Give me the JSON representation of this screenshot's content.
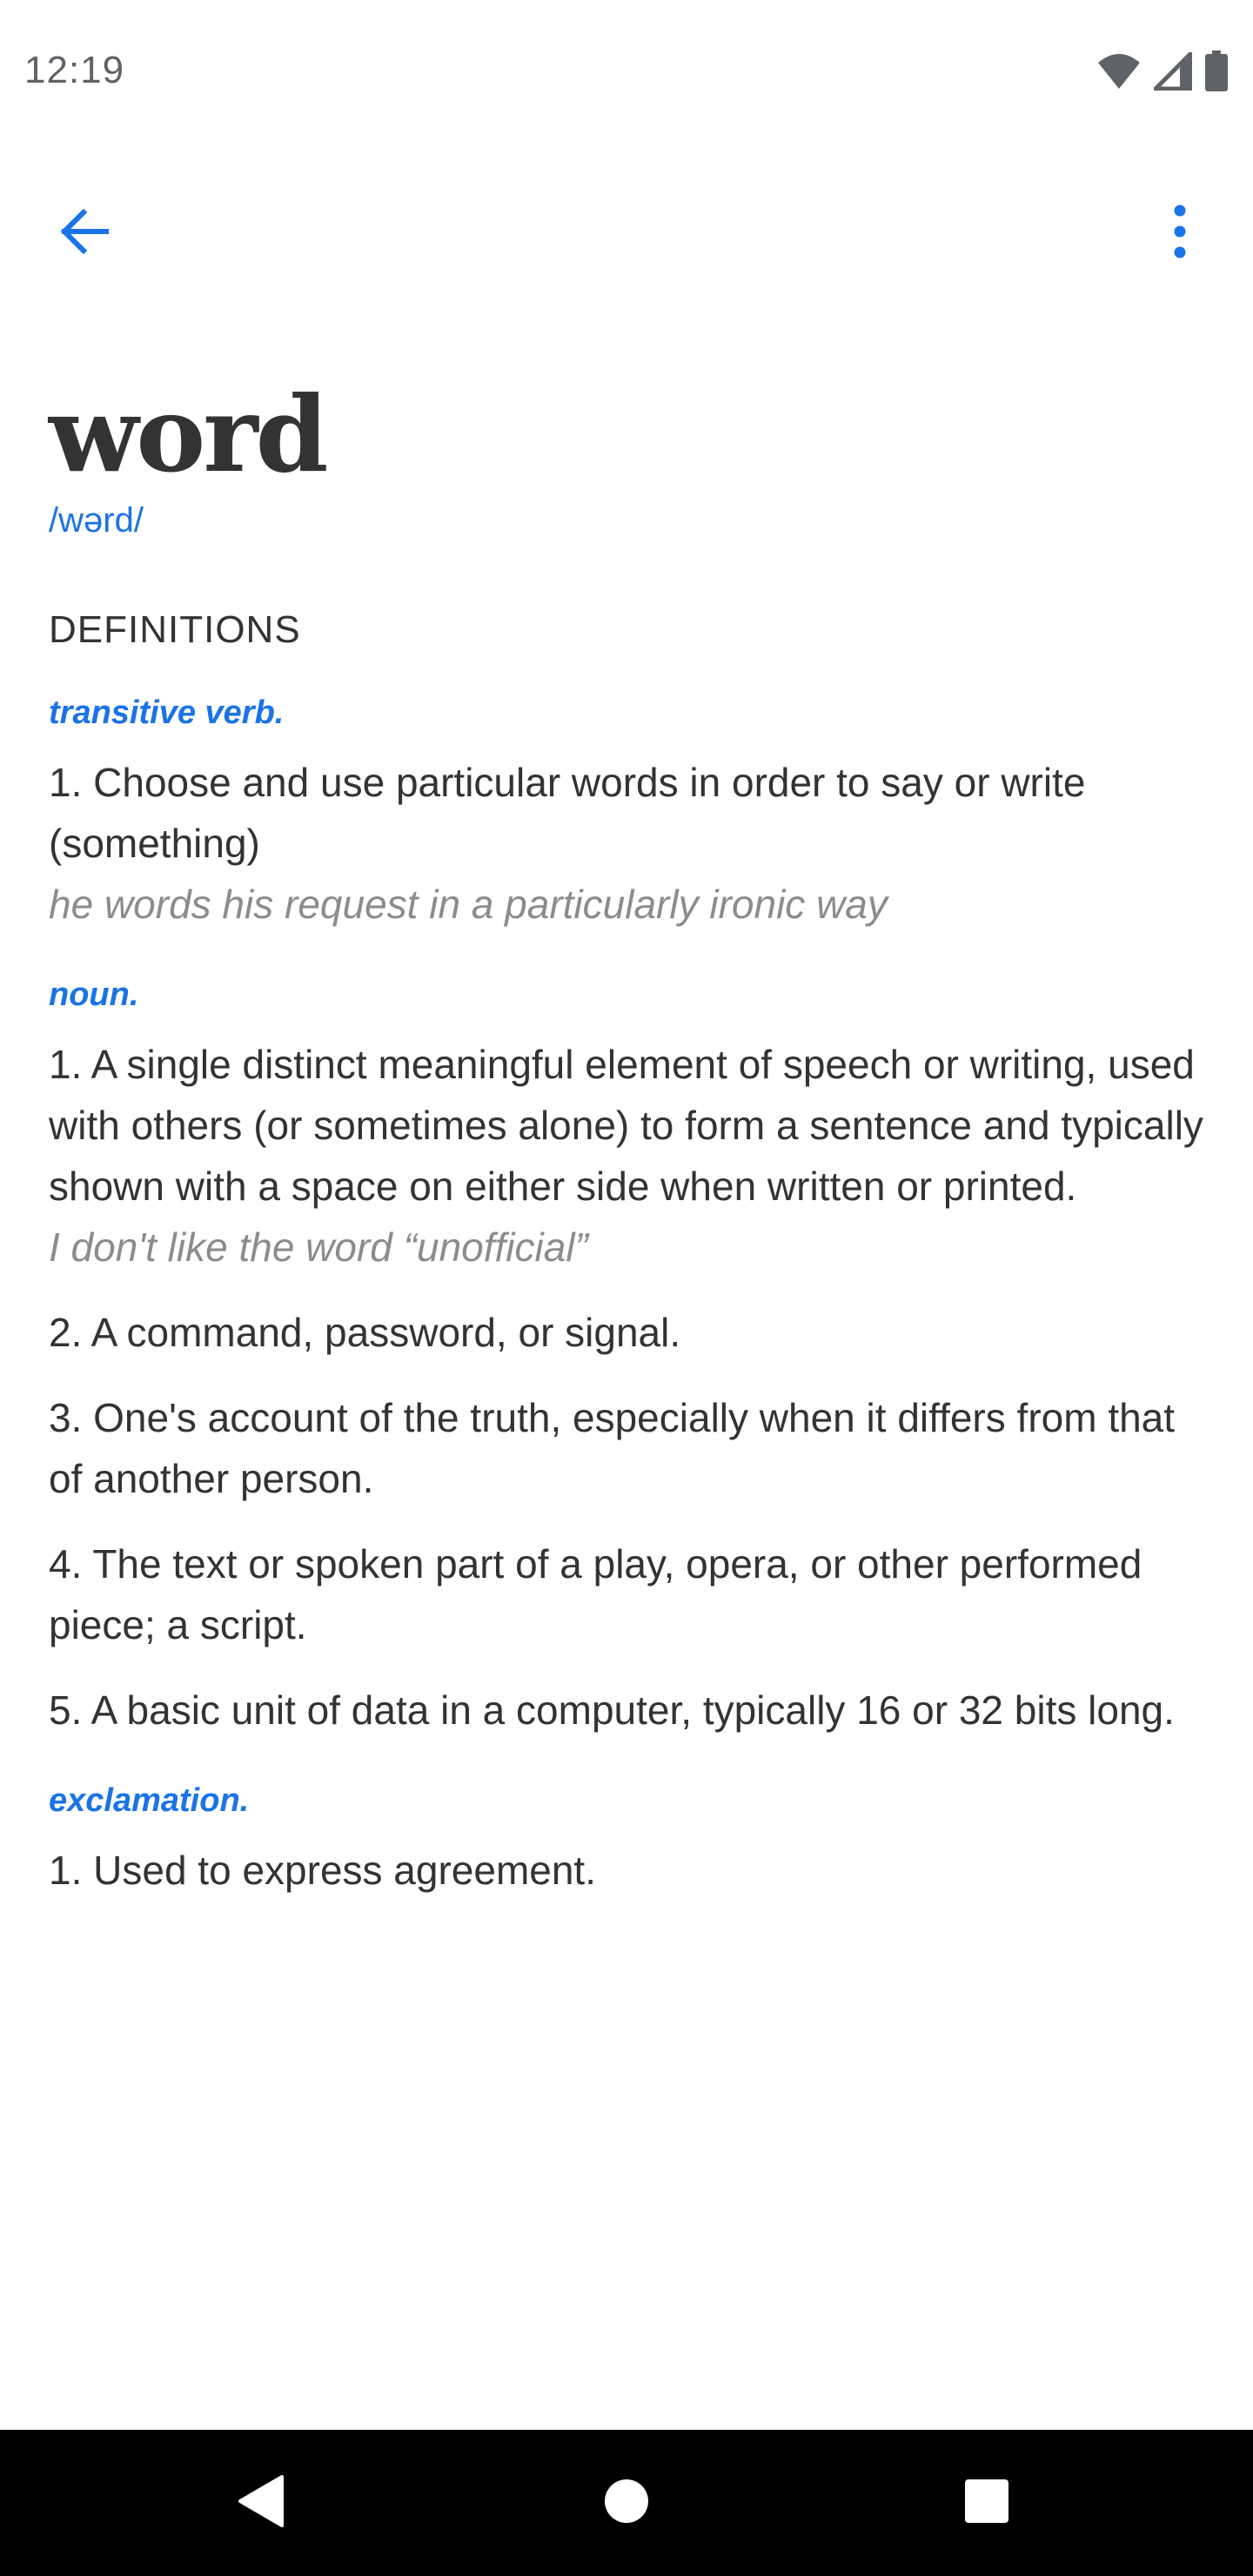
{
  "status_bar": {
    "time": "12:19",
    "icons": [
      "wifi-icon",
      "cell-signal-icon",
      "battery-icon"
    ]
  },
  "app_bar": {
    "back_icon": "arrow-left-icon",
    "menu_icon": "more-vert-icon",
    "accent_color": "#1a73e8"
  },
  "entry": {
    "word": "word",
    "phonetic": "/wərd/",
    "definitions_label": "DEFINITIONS",
    "groups": [
      {
        "pos": "transitive verb.",
        "senses": [
          {
            "text": "1. Choose and use particular words in order to say or write (something)",
            "example": "he words his request in a particularly ironic way"
          }
        ]
      },
      {
        "pos": "noun.",
        "senses": [
          {
            "text": "1. A single distinct meaningful element of speech or writing, used with others (or sometimes alone) to form a sentence and typically shown with a space on either side when written or printed.",
            "example": "I don't like the word “unofficial”"
          },
          {
            "text": "2. A command, password, or signal."
          },
          {
            "text": "3. One's account of the truth, especially when it differs from that of another person."
          },
          {
            "text": "4. The text or spoken part of a play, opera, or other performed piece; a script."
          },
          {
            "text": "5. A basic unit of data in a computer, typically 16 or 32 bits long."
          }
        ]
      },
      {
        "pos": "exclamation.",
        "senses": [
          {
            "text": "1. Used to express agreement."
          }
        ]
      }
    ]
  },
  "nav_bar": {
    "buttons": [
      "back-triangle-icon",
      "home-circle-icon",
      "recents-square-icon"
    ]
  }
}
